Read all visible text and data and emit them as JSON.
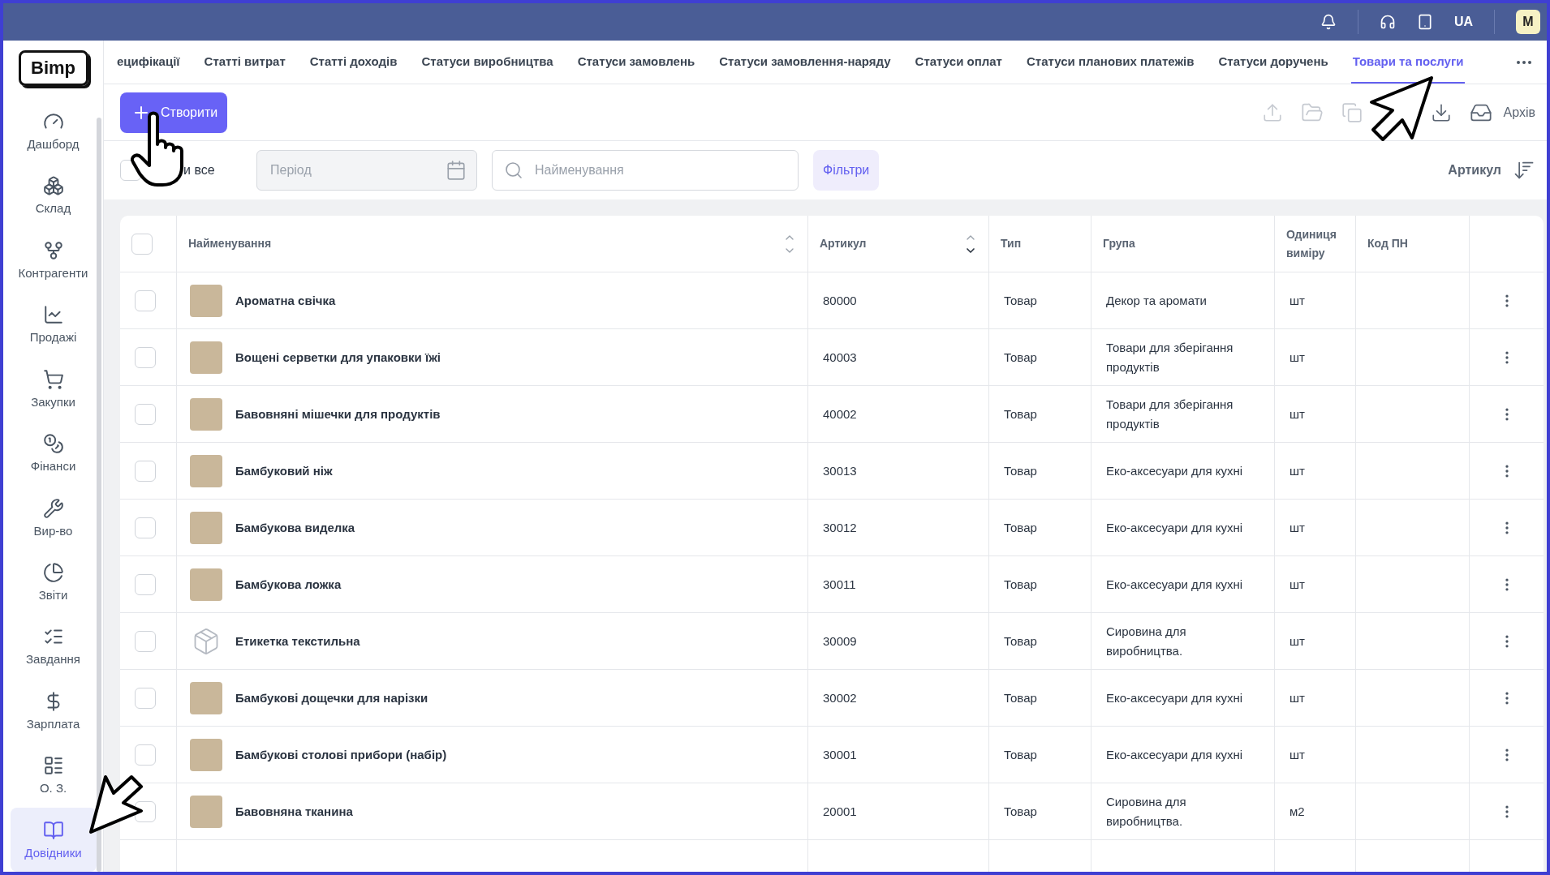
{
  "top_bar": {
    "language": "UA",
    "avatar": "M"
  },
  "sidebar": {
    "logo": "Bimp",
    "items": [
      {
        "label": "Дашборд",
        "selected": false
      },
      {
        "label": "Склад",
        "selected": false
      },
      {
        "label": "Контрагенти",
        "selected": false
      },
      {
        "label": "Продажі",
        "selected": false
      },
      {
        "label": "Закупки",
        "selected": false
      },
      {
        "label": "Фінанси",
        "selected": false
      },
      {
        "label": "Вир-во",
        "selected": false
      },
      {
        "label": "Звіти",
        "selected": false
      },
      {
        "label": "Завдання",
        "selected": false
      },
      {
        "label": "Зарплата",
        "selected": false
      },
      {
        "label": "О. З.",
        "selected": false
      },
      {
        "label": "Довідники",
        "selected": true
      }
    ]
  },
  "tabs": [
    {
      "label": "ецифікації",
      "selected": false
    },
    {
      "label": "Статті витрат",
      "selected": false
    },
    {
      "label": "Статті доходів",
      "selected": false
    },
    {
      "label": "Статуси виробництва",
      "selected": false
    },
    {
      "label": "Статуси замовлень",
      "selected": false
    },
    {
      "label": "Статуси замовлення-наряду",
      "selected": false
    },
    {
      "label": "Статуси оплат",
      "selected": false
    },
    {
      "label": "Статуси планових платежів",
      "selected": false
    },
    {
      "label": "Статуси доручень",
      "selected": false
    },
    {
      "label": "Товари та послуги",
      "selected": true
    }
  ],
  "toolbar": {
    "create_button": "Створити",
    "archive_button": "Архів"
  },
  "filters": {
    "select_all": {
      "label": "и все",
      "checked": false
    },
    "period": {
      "placeholder": "Період"
    },
    "search": {
      "placeholder": "Найменування"
    },
    "filters_button": "Фільтри",
    "sort_label": "Артикул"
  },
  "table": {
    "select_all_rows": {
      "checked": false
    },
    "columns": [
      "Найменування",
      "Артикул",
      "Тип",
      "Група",
      "Одиниця виміру",
      "Код ПН"
    ],
    "rows": [
      {
        "kind": "photo",
        "name": "Ароматна свічка",
        "sku": "80000",
        "type": "Товар",
        "group": "Декор та аромати",
        "unit": "шт",
        "checked": false
      },
      {
        "kind": "photo",
        "name": "Вощені серветки для упаковки їжі",
        "sku": "40003",
        "type": "Товар",
        "group": "Товари для зберігання продуктів",
        "unit": "шт",
        "checked": false
      },
      {
        "kind": "photo",
        "name": "Бавовняні мішечки для продуктів",
        "sku": "40002",
        "type": "Товар",
        "group": "Товари для зберігання продуктів",
        "unit": "шт",
        "checked": false
      },
      {
        "kind": "photo",
        "name": "Бамбуковий ніж",
        "sku": "30013",
        "type": "Товар",
        "group": "Еко-аксесуари для кухні",
        "unit": "шт",
        "checked": false
      },
      {
        "kind": "photo",
        "name": "Бамбукова виделка",
        "sku": "30012",
        "type": "Товар",
        "group": "Еко-аксесуари для кухні",
        "unit": "шт",
        "checked": false
      },
      {
        "kind": "photo",
        "name": "Бамбукова ложка",
        "sku": "30011",
        "type": "Товар",
        "group": "Еко-аксесуари для кухні",
        "unit": "шт",
        "checked": false
      },
      {
        "kind": "placeholder",
        "name": "Етикетка текстильна",
        "sku": "30009",
        "type": "Товар",
        "group": "Сировина для виробництва.",
        "unit": "шт",
        "checked": false
      },
      {
        "kind": "photo",
        "name": "Бамбукові дощечки для нарізки",
        "sku": "30002",
        "type": "Товар",
        "group": "Еко-аксесуари для кухні",
        "unit": "шт",
        "checked": false
      },
      {
        "kind": "photo",
        "name": "Бамбукові столові прибори (набір)",
        "sku": "30001",
        "type": "Товар",
        "group": "Еко-аксесуари для кухні",
        "unit": "шт",
        "checked": false
      },
      {
        "kind": "photo",
        "name": "Бавовняна тканина",
        "sku": "20001",
        "type": "Товар",
        "group": "Сировина для виробництва.",
        "unit": "м2",
        "checked": false
      }
    ]
  }
}
